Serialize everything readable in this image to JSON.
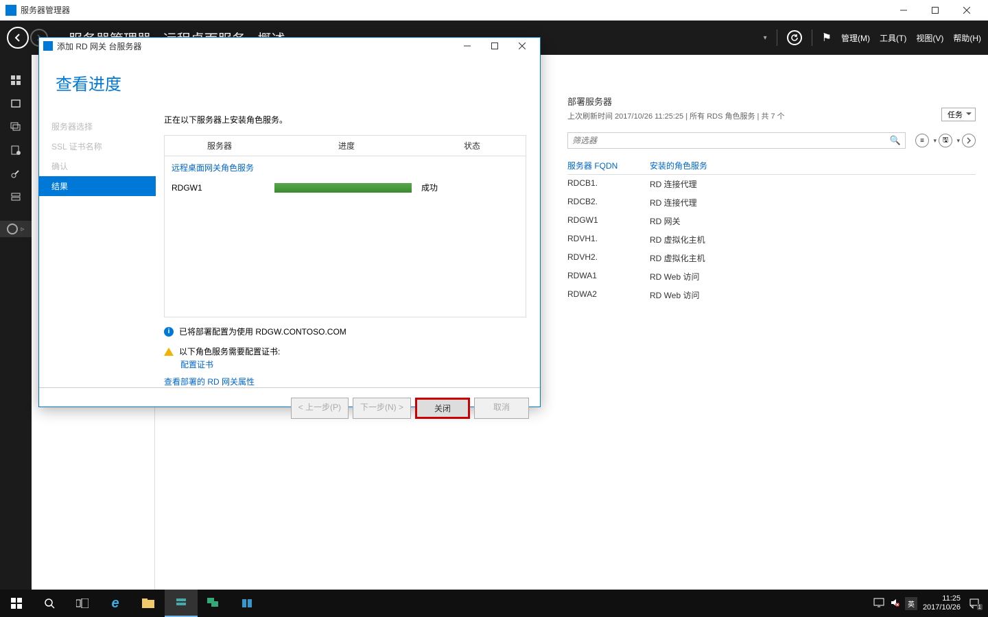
{
  "parent_window": {
    "title": "服务器管理器"
  },
  "header": {
    "breadcrumb": "服务器管理器 · 远程桌面服务 · 概述",
    "menus": [
      "管理(M)",
      "工具(T)",
      "视图(V)",
      "帮助(H)"
    ]
  },
  "deployment_panel": {
    "title": "部署服务器",
    "refresh_line": "上次刷新时间 2017/10/26 11:25:25 | 所有 RDS 角色服务 | 共 7 个",
    "tasks_label": "任务",
    "filter_placeholder": "筛选器",
    "col_server": "服务器 FQDN",
    "col_roles": "安装的角色服务",
    "rows": [
      {
        "fqdn": "RDCB1.",
        "role": "RD 连接代理"
      },
      {
        "fqdn": "RDCB2.",
        "role": "RD 连接代理"
      },
      {
        "fqdn": "RDGW1",
        "role": "RD 网关"
      },
      {
        "fqdn": "RDVH1.",
        "role": "RD 虚拟化主机"
      },
      {
        "fqdn": "RDVH2.",
        "role": "RD 虚拟化主机"
      },
      {
        "fqdn": "RDWA1",
        "role": "RD Web 访问"
      },
      {
        "fqdn": "RDWA2",
        "role": "RD Web 访问"
      }
    ]
  },
  "modal": {
    "title": "添加 RD 网关 台服务器",
    "heading": "查看进度",
    "steps": [
      {
        "label": "服务器选择",
        "active": false
      },
      {
        "label": "SSL 证书名称",
        "active": false
      },
      {
        "label": "确认",
        "active": false
      },
      {
        "label": "结果",
        "active": true
      }
    ],
    "install_text": "正在以下服务器上安装角色服务。",
    "cols": {
      "server": "服务器",
      "progress": "进度",
      "state": "状态"
    },
    "section_label": "远程桌面网关角色服务",
    "result_rows": [
      {
        "name": "RDGW1",
        "state": "成功"
      }
    ],
    "info_text": "已将部署配置为使用 RDGW.CONTOSO.COM",
    "warn_text": "以下角色服务需要配置证书:",
    "configure_cert": "配置证书",
    "view_props": "查看部署的 RD 网关属性",
    "buttons": {
      "prev": "< 上一步(P)",
      "next": "下一步(N) >",
      "close": "关闭",
      "cancel": "取消"
    }
  },
  "taskbar": {
    "ime": "英",
    "time": "11:25",
    "date": "2017/10/26",
    "notif_count": "1"
  }
}
